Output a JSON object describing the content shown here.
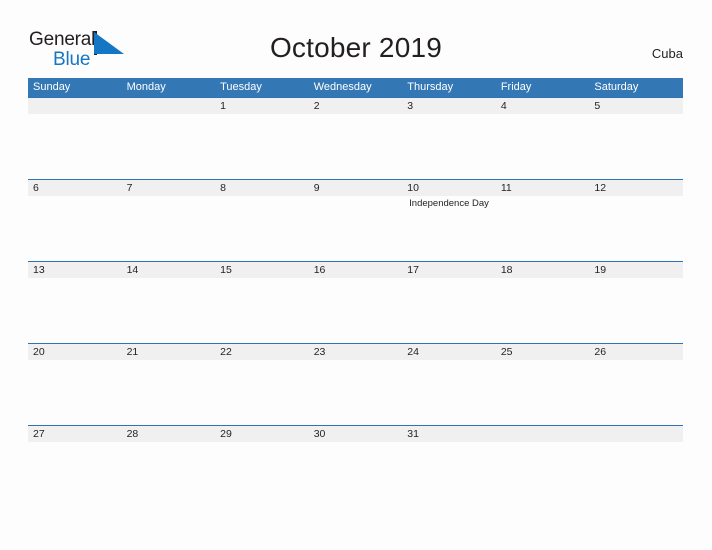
{
  "logo": {
    "word_one": "General",
    "word_two": "Blue",
    "flag_icon": "triangle-flag-icon",
    "accent_color": "#1577c4"
  },
  "header": {
    "title": "October 2019",
    "country": "Cuba"
  },
  "theme": {
    "header_band": "#3477b5",
    "row_band": "#f0f0f0",
    "row_rule": "#2e74b5",
    "text": "#231f20",
    "page_background": "#fdfdfd"
  },
  "calendar": {
    "day_headers": [
      "Sunday",
      "Monday",
      "Tuesday",
      "Wednesday",
      "Thursday",
      "Friday",
      "Saturday"
    ],
    "weeks": [
      {
        "days": [
          {
            "date": "",
            "event": ""
          },
          {
            "date": "",
            "event": ""
          },
          {
            "date": "1",
            "event": ""
          },
          {
            "date": "2",
            "event": ""
          },
          {
            "date": "3",
            "event": ""
          },
          {
            "date": "4",
            "event": ""
          },
          {
            "date": "5",
            "event": ""
          }
        ]
      },
      {
        "days": [
          {
            "date": "6",
            "event": ""
          },
          {
            "date": "7",
            "event": ""
          },
          {
            "date": "8",
            "event": ""
          },
          {
            "date": "9",
            "event": ""
          },
          {
            "date": "10",
            "event": "Independence Day"
          },
          {
            "date": "11",
            "event": ""
          },
          {
            "date": "12",
            "event": ""
          }
        ]
      },
      {
        "days": [
          {
            "date": "13",
            "event": ""
          },
          {
            "date": "14",
            "event": ""
          },
          {
            "date": "15",
            "event": ""
          },
          {
            "date": "16",
            "event": ""
          },
          {
            "date": "17",
            "event": ""
          },
          {
            "date": "18",
            "event": ""
          },
          {
            "date": "19",
            "event": ""
          }
        ]
      },
      {
        "days": [
          {
            "date": "20",
            "event": ""
          },
          {
            "date": "21",
            "event": ""
          },
          {
            "date": "22",
            "event": ""
          },
          {
            "date": "23",
            "event": ""
          },
          {
            "date": "24",
            "event": ""
          },
          {
            "date": "25",
            "event": ""
          },
          {
            "date": "26",
            "event": ""
          }
        ]
      },
      {
        "days": [
          {
            "date": "27",
            "event": ""
          },
          {
            "date": "28",
            "event": ""
          },
          {
            "date": "29",
            "event": ""
          },
          {
            "date": "30",
            "event": ""
          },
          {
            "date": "31",
            "event": ""
          },
          {
            "date": "",
            "event": ""
          },
          {
            "date": "",
            "event": ""
          }
        ]
      }
    ]
  }
}
